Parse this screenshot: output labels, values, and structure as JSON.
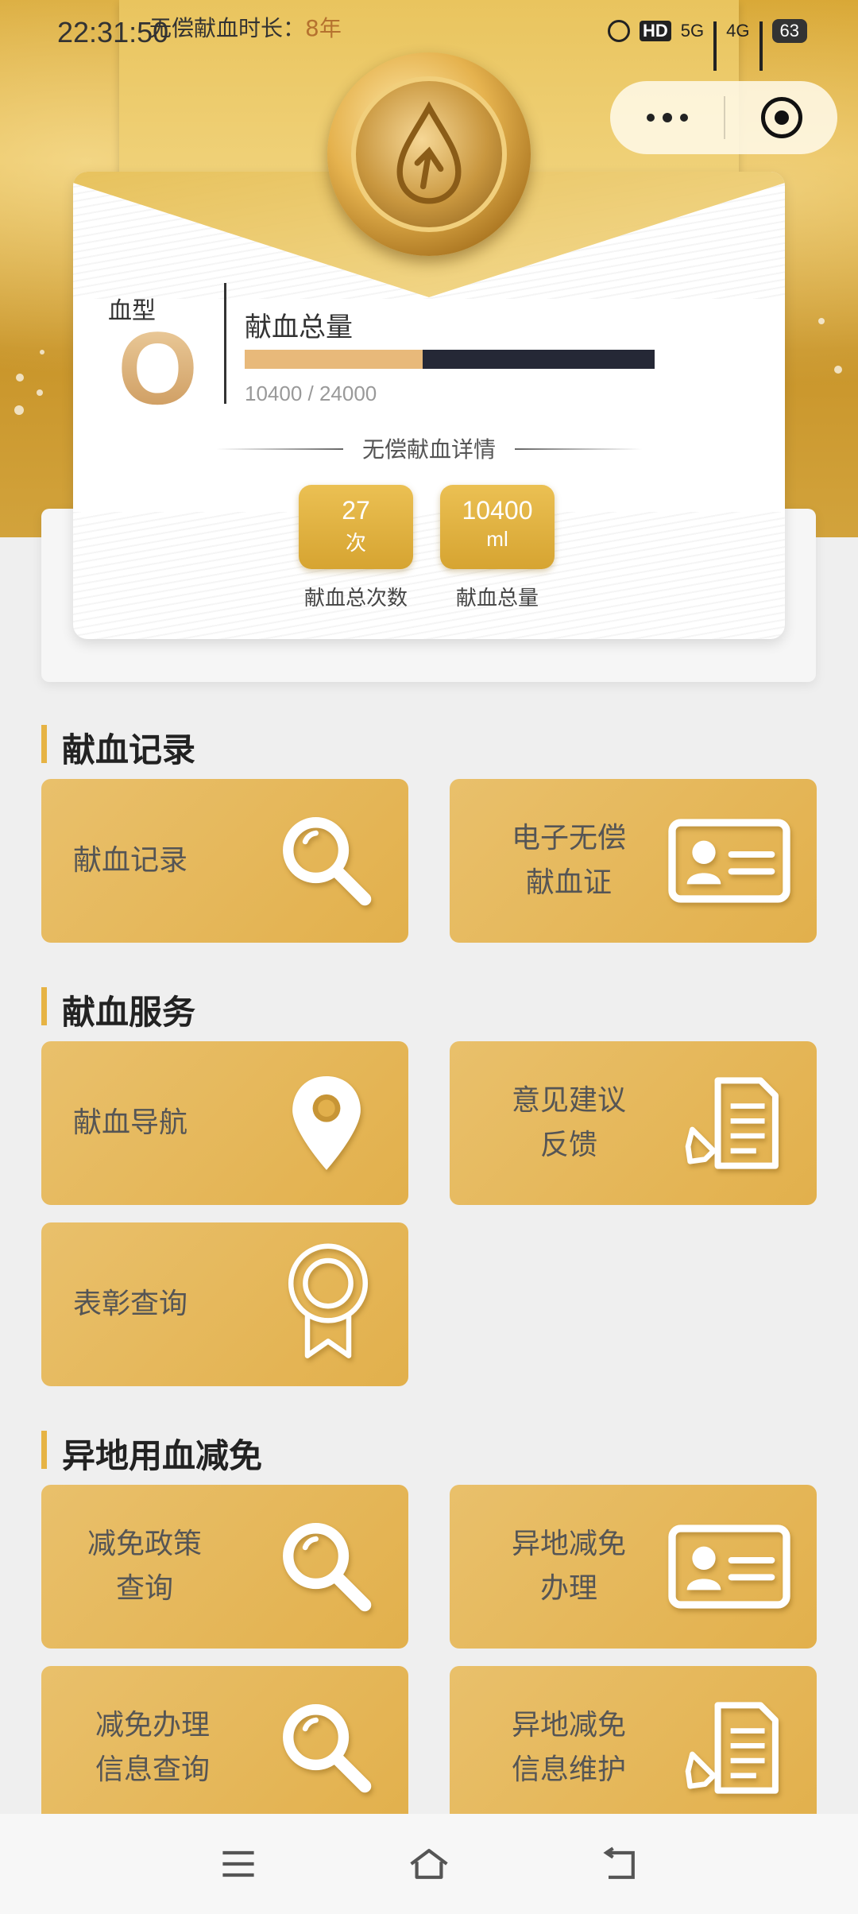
{
  "status_bar": {
    "time": "22:31:50",
    "banner_label": "无偿献血时长：",
    "banner_value": "8年",
    "hd_label": "HD",
    "net1": "5G",
    "net2": "4G",
    "battery": "63"
  },
  "card": {
    "blood_type_label": "血型",
    "blood_type": "O",
    "total_label": "献血总量",
    "progress_text": "10400 / 24000",
    "progress_fraction": 0.4333,
    "detail_title": "无偿献血详情",
    "stats": [
      {
        "value": "27",
        "unit": "次",
        "label": "献血总次数"
      },
      {
        "value": "10400",
        "unit": "ml",
        "label": "献血总量"
      }
    ]
  },
  "sections": [
    {
      "title": "献血记录",
      "tiles": [
        {
          "label": "献血记录",
          "icon": "search-icon"
        },
        {
          "label": "电子无偿献血证",
          "icon": "id-card-icon"
        }
      ]
    },
    {
      "title": "献血服务",
      "tiles": [
        {
          "label": "献血导航",
          "icon": "location-pin-icon"
        },
        {
          "label": "意见建议反馈",
          "icon": "document-pen-icon"
        },
        {
          "label": "表彰查询",
          "icon": "award-ribbon-icon"
        }
      ]
    },
    {
      "title": "异地用血减免",
      "tiles": [
        {
          "label": "减免政策查询",
          "icon": "search-icon"
        },
        {
          "label": "异地减免办理",
          "icon": "id-card-icon"
        },
        {
          "label": "减免办理信息查询",
          "icon": "search-icon"
        },
        {
          "label": "异地减免信息维护",
          "icon": "document-pen-icon"
        }
      ]
    }
  ],
  "colors": {
    "gold": "#e2b04c",
    "progress_fill": "#e8b97a",
    "progress_track": "#252836"
  }
}
